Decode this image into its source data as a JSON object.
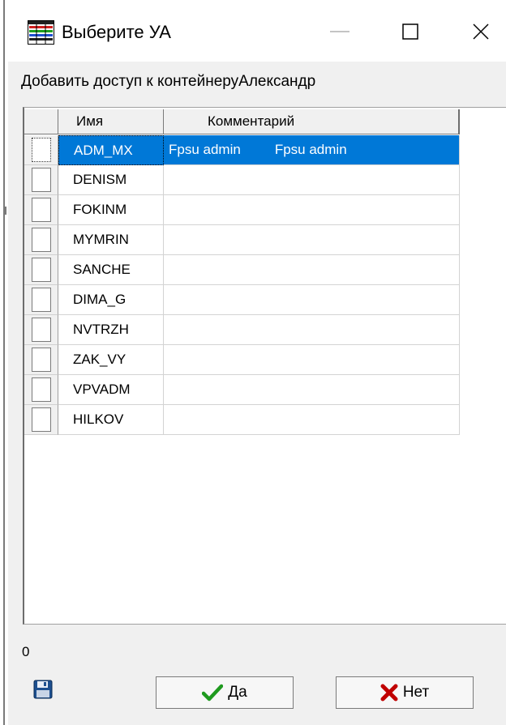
{
  "window": {
    "title": "Выберите УА",
    "icon": "table-grid-icon",
    "controls": [
      "minimize-icon",
      "maximize-icon",
      "close-icon"
    ]
  },
  "dialog": {
    "caption": "Добавить доступ к контейнеруАлександр",
    "columns": {
      "check": "",
      "name": "Имя",
      "comment": "Комментарий"
    },
    "rows": [
      {
        "name": "ADM_MX",
        "comment_a": "Fpsu admin",
        "comment_b": "Fpsu admin",
        "checked": false,
        "selected": true
      },
      {
        "name": "DENISM",
        "comment_a": "",
        "comment_b": "",
        "checked": false,
        "selected": false
      },
      {
        "name": "FOKINM",
        "comment_a": "",
        "comment_b": "",
        "checked": false,
        "selected": false
      },
      {
        "name": "MYMRIN",
        "comment_a": "",
        "comment_b": "",
        "checked": false,
        "selected": false
      },
      {
        "name": "SANCHE",
        "comment_a": "",
        "comment_b": "",
        "checked": false,
        "selected": false
      },
      {
        "name": "DIMA_G",
        "comment_a": "",
        "comment_b": "",
        "checked": false,
        "selected": false
      },
      {
        "name": "NVTRZH",
        "comment_a": "",
        "comment_b": "",
        "checked": false,
        "selected": false
      },
      {
        "name": "ZAK_VY",
        "comment_a": "",
        "comment_b": "",
        "checked": false,
        "selected": false
      },
      {
        "name": "VPVADM",
        "comment_a": "",
        "comment_b": "",
        "checked": false,
        "selected": false
      },
      {
        "name": "HILKOV",
        "comment_a": "",
        "comment_b": "",
        "checked": false,
        "selected": false
      }
    ],
    "count": "0",
    "buttons": {
      "save_icon": "floppy-disk-icon",
      "yes_label": "Да",
      "yes_icon": "check-mark-icon",
      "no_label": "Нет",
      "no_icon": "x-mark-icon"
    }
  },
  "colors": {
    "selection": "#0078d7",
    "dialog_bg": "#f0f0f0",
    "yes_icon": "#1f9a1f",
    "no_icon": "#c00000"
  }
}
